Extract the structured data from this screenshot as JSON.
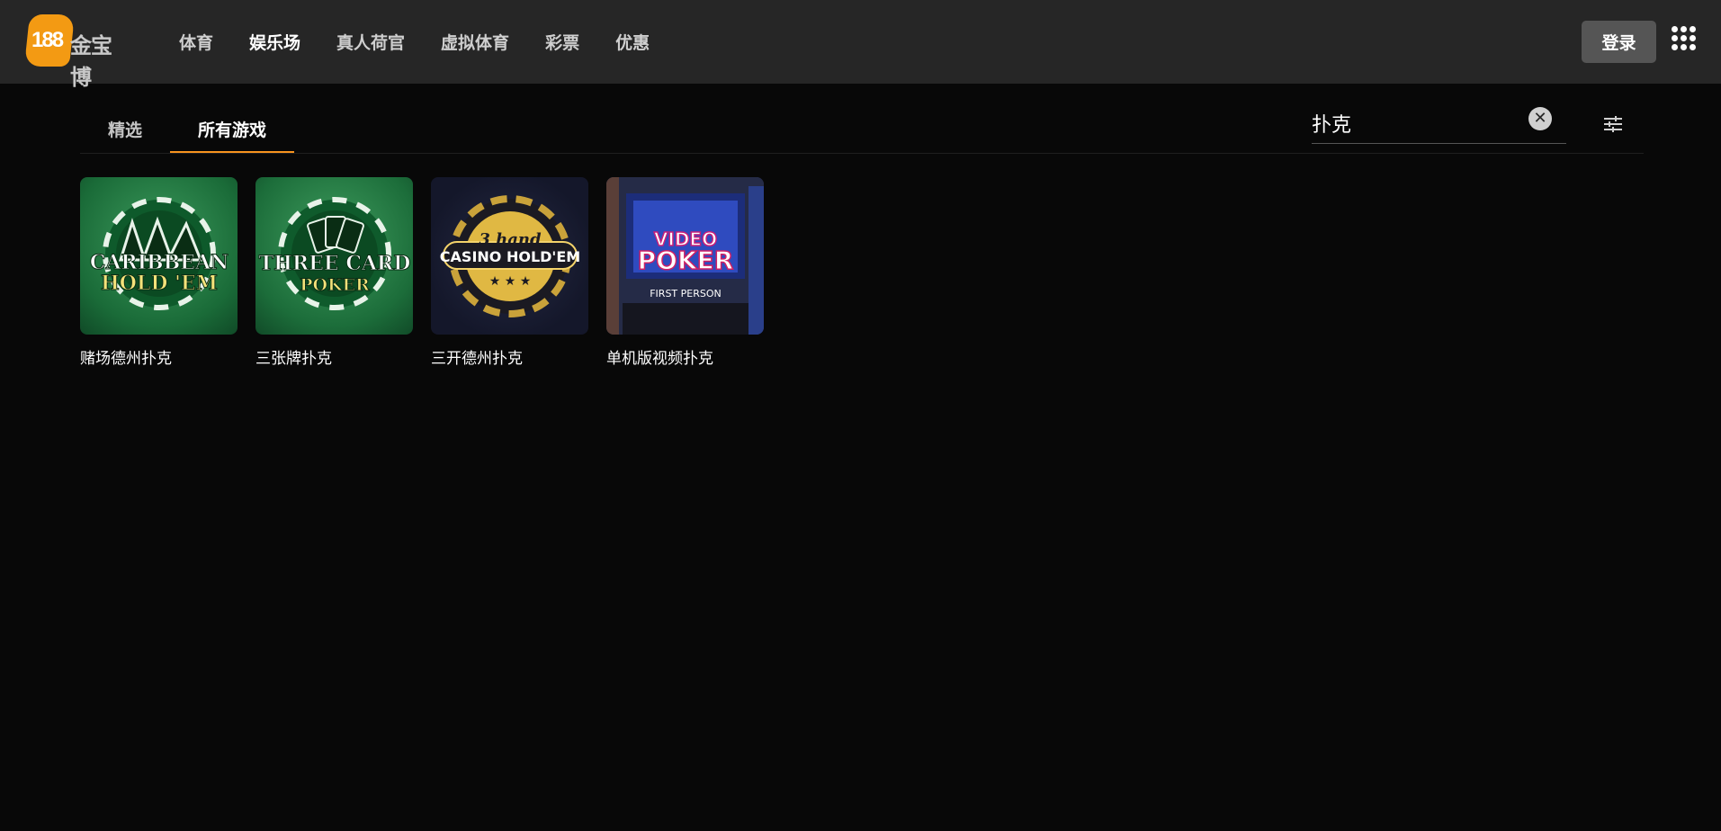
{
  "header": {
    "logo_number": "188",
    "logo_text": "金宝博",
    "nav": [
      {
        "label": "体育"
      },
      {
        "label": "娱乐场"
      },
      {
        "label": "真人荷官"
      },
      {
        "label": "虚拟体育"
      },
      {
        "label": "彩票"
      },
      {
        "label": "优惠"
      }
    ],
    "login_label": "登录"
  },
  "tabs": [
    {
      "label": "精选"
    },
    {
      "label": "所有游戏"
    }
  ],
  "search": {
    "value": "扑克",
    "clear_symbol": "✕"
  },
  "games": [
    {
      "title": "赌场德州扑克",
      "art": [
        "CARIBBEAN",
        "HOLD 'EM"
      ]
    },
    {
      "title": "三张牌扑克",
      "art": [
        "THREE CARD",
        "POKER"
      ]
    },
    {
      "title": "三开德州扑克",
      "art": [
        "3 hand",
        "CASINO HOLD'EM"
      ]
    },
    {
      "title": "单机版视频扑克",
      "art": [
        "VIDEO",
        "POKER",
        "FIRST PERSON"
      ]
    }
  ],
  "colors": {
    "accent": "#f7931e",
    "header_bg": "#262626",
    "page_bg": "#080808"
  }
}
